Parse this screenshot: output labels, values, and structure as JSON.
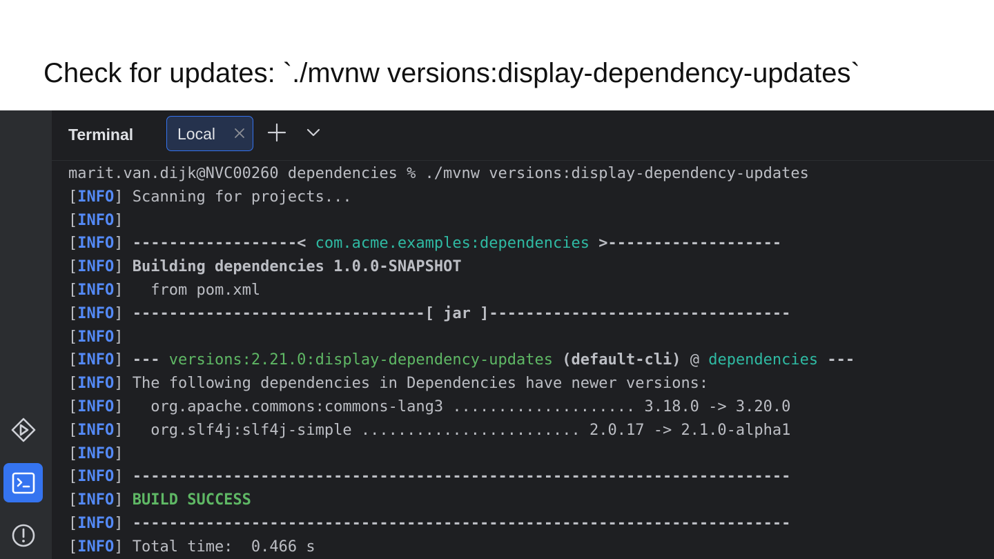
{
  "slide": {
    "title": "Check for updates: `./mvnw versions:display-dependency-updates`"
  },
  "toolwindow": {
    "title": "Terminal",
    "tabs": [
      {
        "label": "Local",
        "active": true
      }
    ],
    "actions": [
      "add-tab",
      "more-tabs-dropdown"
    ]
  },
  "sidebar": {
    "icons": [
      "run-services-icon",
      "terminal-icon",
      "problems-icon"
    ],
    "active": "terminal-icon"
  },
  "terminal": {
    "info_tag": "INFO",
    "prompt": "marit.van.dijk@NVC00260 dependencies % ./mvnw versions:display-dependency-updates",
    "lines": {
      "scanning": "Scanning for projects...",
      "project_left": "------------------< ",
      "project_id": "com.acme.examples:dependencies",
      "project_right": " >-------------------",
      "building": "Building dependencies 1.0.0-SNAPSHOT",
      "from_pom": "  from pom.xml",
      "jar_left": "--------------------------------[ ",
      "jar": "jar",
      "jar_right": " ]---------------------------------",
      "plugin_prefix": "--- ",
      "plugin": "versions:2.21.0:display-dependency-updates",
      "plugin_exec": " (default-cli)",
      "plugin_at": " @ ",
      "plugin_module": "dependencies",
      "plugin_suffix": " ---",
      "following": "The following dependencies in Dependencies have newer versions:",
      "dep1": "  org.apache.commons:commons-lang3 .................... 3.18.0 -> 3.20.0",
      "dep2": "  org.slf4j:slf4j-simple ........................ 2.0.17 -> 2.1.0-alpha1",
      "separator": "------------------------------------------------------------------------",
      "build_success": "BUILD SUCCESS",
      "total_time": "Total time:  0.466 s"
    }
  },
  "colors": {
    "background": "#1e1f22",
    "sidebar": "#2b2d30",
    "accent": "#3574f0",
    "info": "#548af7",
    "cyan": "#2fbaa3",
    "green": "#5fb865",
    "text": "#bcbec4"
  }
}
